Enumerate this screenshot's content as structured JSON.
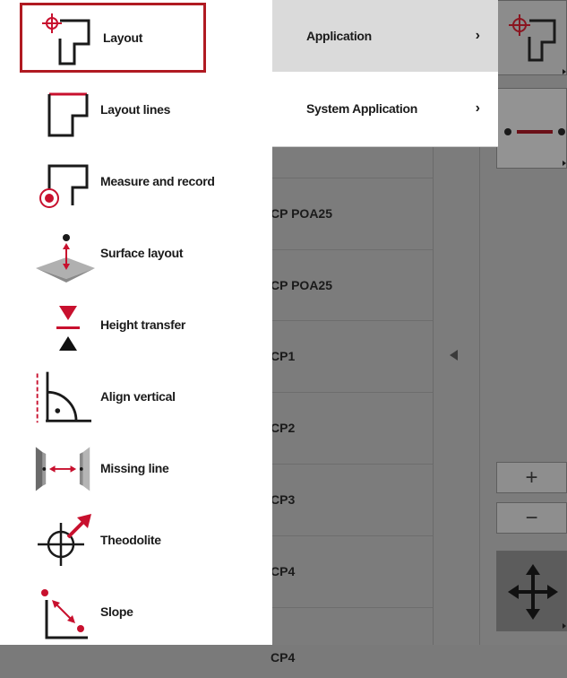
{
  "menu": {
    "items": [
      {
        "label": "Layout",
        "icon": "layout-icon",
        "selected": true
      },
      {
        "label": "Layout lines",
        "icon": "layout-lines-icon"
      },
      {
        "label": "Measure and record",
        "icon": "measure-record-icon"
      },
      {
        "label": "Surface layout",
        "icon": "surface-layout-icon"
      },
      {
        "label": "Height transfer",
        "icon": "height-transfer-icon"
      },
      {
        "label": "Align vertical",
        "icon": "align-vertical-icon"
      },
      {
        "label": "Missing line",
        "icon": "missing-line-icon"
      },
      {
        "label": "Theodolite",
        "icon": "theodolite-icon"
      },
      {
        "label": "Slope",
        "icon": "slope-icon"
      }
    ]
  },
  "submenu": {
    "items": [
      {
        "label": "Application",
        "chevron": "›"
      },
      {
        "label": "System Application",
        "chevron": "›"
      }
    ]
  },
  "background": {
    "rows": [
      "CP POA25",
      "CP POA25",
      "CP1",
      "CP2",
      "CP3",
      "CP4",
      "CP4"
    ],
    "zoom_in": "+",
    "zoom_out": "−"
  },
  "colors": {
    "accent": "#c8102e",
    "selection_border": "#b01a22",
    "icon_dark": "#1a1a1a",
    "submenu_selected_bg": "#dadada"
  }
}
